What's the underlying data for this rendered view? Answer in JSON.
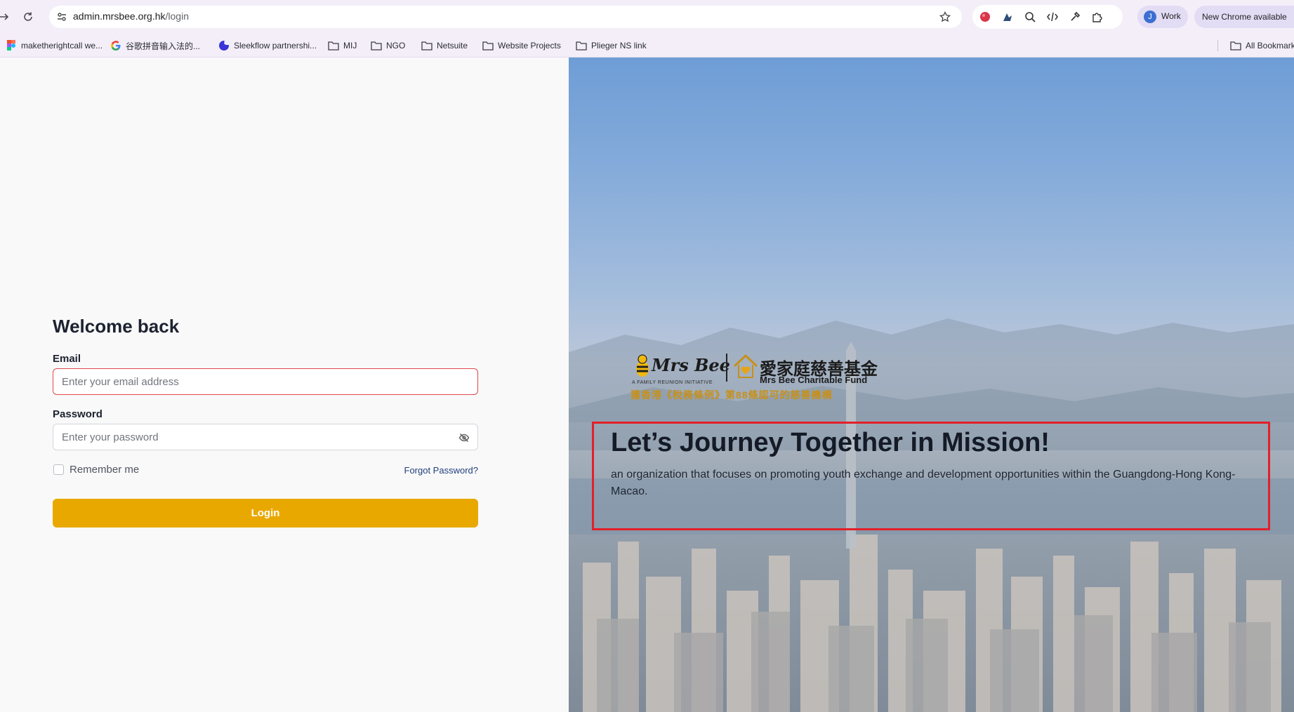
{
  "browser": {
    "url_host": "admin.mrsbee.org.hk",
    "url_path": "/login",
    "profile_label": "Work",
    "profile_initial": "J",
    "update_label": "New Chrome available",
    "bookmarks": [
      {
        "label": "maketherightcall we...",
        "icon": "colorful-app-icon"
      },
      {
        "label": "谷歌拼音输入法的...",
        "icon": "google-icon"
      },
      {
        "label": "Sleekflow partnershi...",
        "icon": "sleekflow-icon"
      },
      {
        "label": "MIJ",
        "icon": "folder-icon"
      },
      {
        "label": "NGO",
        "icon": "folder-icon"
      },
      {
        "label": "Netsuite",
        "icon": "folder-icon"
      },
      {
        "label": "Website Projects",
        "icon": "folder-icon"
      },
      {
        "label": "Plieger NS link",
        "icon": "folder-icon"
      }
    ],
    "all_bookmarks_label": "All Bookmarks"
  },
  "login": {
    "heading": "Welcome back",
    "email_label": "Email",
    "email_placeholder": "Enter your email address",
    "password_label": "Password",
    "password_placeholder": "Enter your password",
    "remember_label": "Remember me",
    "forgot_label": "Forgot Password?",
    "login_label": "Login"
  },
  "hero": {
    "logo_en": "Mrs Bee",
    "logo_tagline": "A FAMILY REUNION INITIATIVE",
    "logo_cn": "愛家庭慈善基金",
    "logo_fund": "Mrs Bee Charitable Fund",
    "logo_cert": "獲香港《稅務條例》第88條認可的慈善機構",
    "title": "Let’s Journey Together in Mission!",
    "subtitle": "an organization that focuses on promoting youth exchange and development opportunities within the Guangdong-Hong Kong-Macao."
  },
  "colors": {
    "accent": "#e9a800",
    "error_border": "#e0484b",
    "highlight_box": "#e2202a",
    "link": "#22407d"
  }
}
